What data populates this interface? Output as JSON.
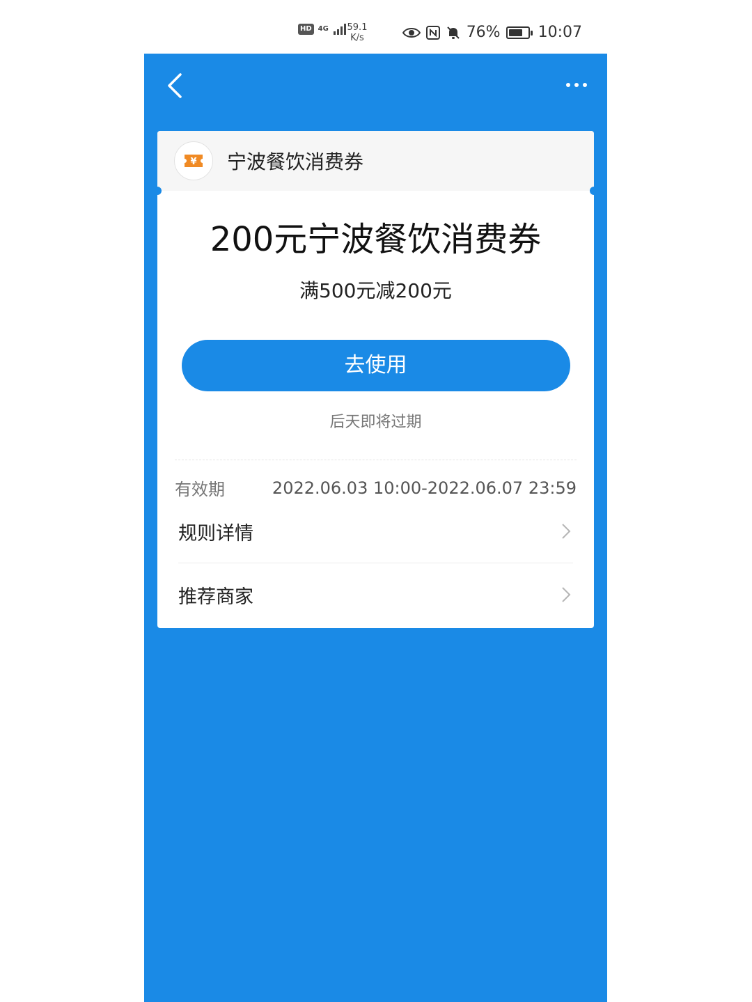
{
  "status_bar": {
    "hd": "HD",
    "network": "4G",
    "speed_value": "59.1",
    "speed_unit": "K/s",
    "battery_pct": "76%",
    "battery_level": 0.76,
    "time": "10:07"
  },
  "nav": {
    "back_icon": "chevron-left-icon",
    "more_icon": "more-dots-icon"
  },
  "coupon": {
    "brand_name": "宁波餐饮消费券",
    "title": "200元宁波餐饮消费券",
    "condition": "满500元减200元",
    "use_button": "去使用",
    "expire_note": "后天即将过期",
    "validity_label": "有效期",
    "validity_value": "2022.06.03 10:00-2022.06.07 23:59",
    "rows": [
      {
        "label": "规则详情"
      },
      {
        "label": "推荐商家"
      }
    ]
  },
  "colors": {
    "primary": "#1a8ae6",
    "icon_accent": "#f08a24"
  }
}
